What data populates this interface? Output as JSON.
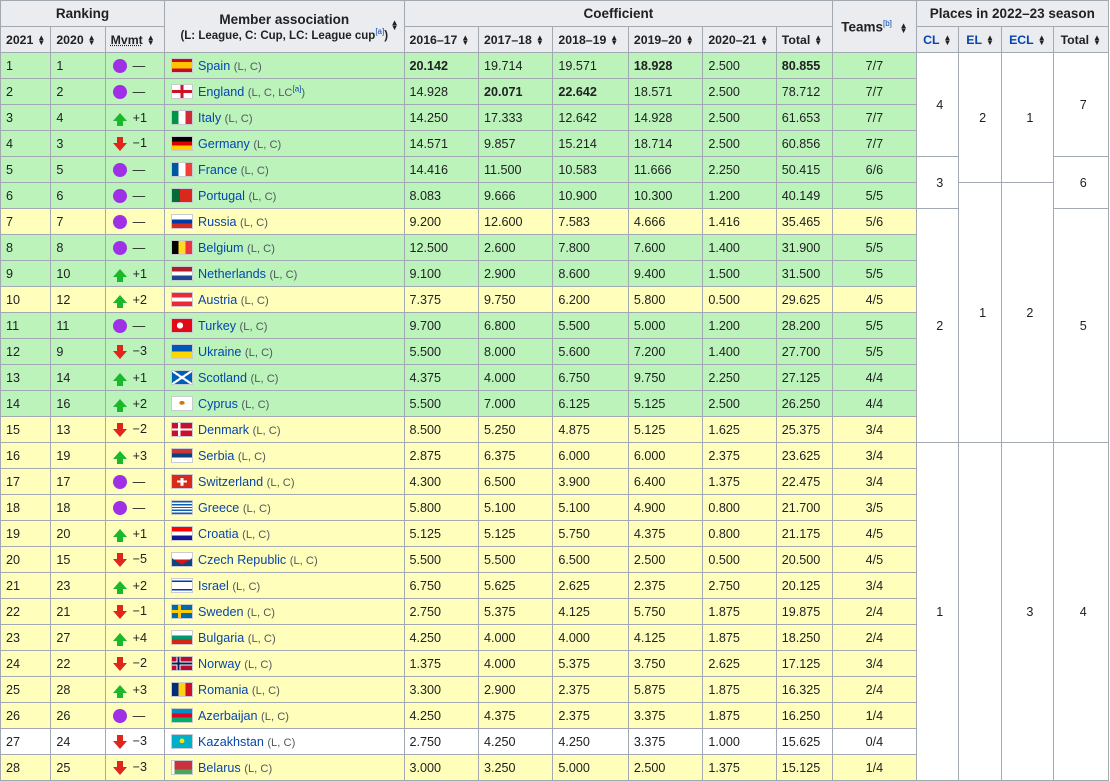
{
  "headers": {
    "ranking": "Ranking",
    "member_association": "Member association",
    "member_note": "(L: League, C: Cup, LC: League cup",
    "member_note_ref": "[a]",
    "member_note_close": ")",
    "coefficient": "Coefficient",
    "teams": "Teams",
    "teams_ref": "[b]",
    "places": "Places in 2022–23 season",
    "col_2021": "2021",
    "col_2020": "2020",
    "col_mvmt": "Mvmt",
    "seasons": [
      "2016–17",
      "2017–18",
      "2018–19",
      "2019–20",
      "2020–21",
      "Total"
    ],
    "places_cols": [
      "CL",
      "EL",
      "ECL",
      "Total"
    ]
  },
  "rows": [
    {
      "r2021": "1",
      "r2020": "1",
      "mv": "same",
      "mvt": "—",
      "name": "Spain",
      "comp": "(L, C)",
      "c": [
        "20.142",
        "19.714",
        "19.571",
        "18.928",
        "2.500",
        "80.855"
      ],
      "bold": [
        true,
        false,
        false,
        true,
        false,
        true
      ],
      "teams": "7/7",
      "bg": "g",
      "flag": "es"
    },
    {
      "r2021": "2",
      "r2020": "2",
      "mv": "same",
      "mvt": "—",
      "name": "England",
      "comp": "(L, C, LC",
      "compref": "[a]",
      "compclose": ")",
      "c": [
        "14.928",
        "20.071",
        "22.642",
        "18.571",
        "2.500",
        "78.712"
      ],
      "bold": [
        false,
        true,
        true,
        false,
        false,
        false
      ],
      "teams": "7/7",
      "bg": "g",
      "flag": "en"
    },
    {
      "r2021": "3",
      "r2020": "4",
      "mv": "up",
      "mvt": "+1",
      "name": "Italy",
      "comp": "(L, C)",
      "c": [
        "14.250",
        "17.333",
        "12.642",
        "14.928",
        "2.500",
        "61.653"
      ],
      "teams": "7/7",
      "bg": "g",
      "flag": "it"
    },
    {
      "r2021": "4",
      "r2020": "3",
      "mv": "down",
      "mvt": "−1",
      "name": "Germany",
      "comp": "(L, C)",
      "c": [
        "14.571",
        "9.857",
        "15.214",
        "18.714",
        "2.500",
        "60.856"
      ],
      "teams": "7/7",
      "bg": "g",
      "flag": "de"
    },
    {
      "r2021": "5",
      "r2020": "5",
      "mv": "same",
      "mvt": "—",
      "name": "France",
      "comp": "(L, C)",
      "c": [
        "14.416",
        "11.500",
        "10.583",
        "11.666",
        "2.250",
        "50.415"
      ],
      "teams": "6/6",
      "bg": "g",
      "flag": "fr"
    },
    {
      "r2021": "6",
      "r2020": "6",
      "mv": "same",
      "mvt": "—",
      "name": "Portugal",
      "comp": "(L, C)",
      "c": [
        "8.083",
        "9.666",
        "10.900",
        "10.300",
        "1.200",
        "40.149"
      ],
      "teams": "5/5",
      "bg": "g",
      "flag": "pt"
    },
    {
      "r2021": "7",
      "r2020": "7",
      "mv": "same",
      "mvt": "—",
      "name": "Russia",
      "comp": "(L, C)",
      "c": [
        "9.200",
        "12.600",
        "7.583",
        "4.666",
        "1.416",
        "35.465"
      ],
      "teams": "5/6",
      "bg": "y",
      "flag": "ru"
    },
    {
      "r2021": "8",
      "r2020": "8",
      "mv": "same",
      "mvt": "—",
      "name": "Belgium",
      "comp": "(L, C)",
      "c": [
        "12.500",
        "2.600",
        "7.800",
        "7.600",
        "1.400",
        "31.900"
      ],
      "teams": "5/5",
      "bg": "g",
      "flag": "be"
    },
    {
      "r2021": "9",
      "r2020": "10",
      "mv": "up",
      "mvt": "+1",
      "name": "Netherlands",
      "comp": "(L, C)",
      "c": [
        "9.100",
        "2.900",
        "8.600",
        "9.400",
        "1.500",
        "31.500"
      ],
      "teams": "5/5",
      "bg": "g",
      "flag": "nl"
    },
    {
      "r2021": "10",
      "r2020": "12",
      "mv": "up",
      "mvt": "+2",
      "name": "Austria",
      "comp": "(L, C)",
      "c": [
        "7.375",
        "9.750",
        "6.200",
        "5.800",
        "0.500",
        "29.625"
      ],
      "teams": "4/5",
      "bg": "y",
      "flag": "at"
    },
    {
      "r2021": "11",
      "r2020": "11",
      "mv": "same",
      "mvt": "—",
      "name": "Turkey",
      "comp": "(L, C)",
      "c": [
        "9.700",
        "6.800",
        "5.500",
        "5.000",
        "1.200",
        "28.200"
      ],
      "teams": "5/5",
      "bg": "g",
      "flag": "tr"
    },
    {
      "r2021": "12",
      "r2020": "9",
      "mv": "down",
      "mvt": "−3",
      "name": "Ukraine",
      "comp": "(L, C)",
      "c": [
        "5.500",
        "8.000",
        "5.600",
        "7.200",
        "1.400",
        "27.700"
      ],
      "teams": "5/5",
      "bg": "g",
      "flag": "ua"
    },
    {
      "r2021": "13",
      "r2020": "14",
      "mv": "up",
      "mvt": "+1",
      "name": "Scotland",
      "comp": "(L, C)",
      "c": [
        "4.375",
        "4.000",
        "6.750",
        "9.750",
        "2.250",
        "27.125"
      ],
      "teams": "4/4",
      "bg": "g",
      "flag": "sc"
    },
    {
      "r2021": "14",
      "r2020": "16",
      "mv": "up",
      "mvt": "+2",
      "name": "Cyprus",
      "comp": "(L, C)",
      "c": [
        "5.500",
        "7.000",
        "6.125",
        "5.125",
        "2.500",
        "26.250"
      ],
      "teams": "4/4",
      "bg": "g",
      "flag": "cy"
    },
    {
      "r2021": "15",
      "r2020": "13",
      "mv": "down",
      "mvt": "−2",
      "name": "Denmark",
      "comp": "(L, C)",
      "c": [
        "8.500",
        "5.250",
        "4.875",
        "5.125",
        "1.625",
        "25.375"
      ],
      "teams": "3/4",
      "bg": "y",
      "flag": "dk"
    },
    {
      "r2021": "16",
      "r2020": "19",
      "mv": "up",
      "mvt": "+3",
      "name": "Serbia",
      "comp": "(L, C)",
      "c": [
        "2.875",
        "6.375",
        "6.000",
        "6.000",
        "2.375",
        "23.625"
      ],
      "teams": "3/4",
      "bg": "y",
      "flag": "rs"
    },
    {
      "r2021": "17",
      "r2020": "17",
      "mv": "same",
      "mvt": "—",
      "name": "Switzerland",
      "comp": "(L, C)",
      "c": [
        "4.300",
        "6.500",
        "3.900",
        "6.400",
        "1.375",
        "22.475"
      ],
      "teams": "3/4",
      "bg": "y",
      "flag": "ch"
    },
    {
      "r2021": "18",
      "r2020": "18",
      "mv": "same",
      "mvt": "—",
      "name": "Greece",
      "comp": "(L, C)",
      "c": [
        "5.800",
        "5.100",
        "5.100",
        "4.900",
        "0.800",
        "21.700"
      ],
      "teams": "3/5",
      "bg": "y",
      "flag": "gr"
    },
    {
      "r2021": "19",
      "r2020": "20",
      "mv": "up",
      "mvt": "+1",
      "name": "Croatia",
      "comp": "(L, C)",
      "c": [
        "5.125",
        "5.125",
        "5.750",
        "4.375",
        "0.800",
        "21.175"
      ],
      "teams": "4/5",
      "bg": "y",
      "flag": "hr"
    },
    {
      "r2021": "20",
      "r2020": "15",
      "mv": "down",
      "mvt": "−5",
      "name": "Czech Republic",
      "comp": "(L, C)",
      "c": [
        "5.500",
        "5.500",
        "6.500",
        "2.500",
        "0.500",
        "20.500"
      ],
      "teams": "4/5",
      "bg": "y",
      "flag": "cz"
    },
    {
      "r2021": "21",
      "r2020": "23",
      "mv": "up",
      "mvt": "+2",
      "name": "Israel",
      "comp": "(L, C)",
      "c": [
        "6.750",
        "5.625",
        "2.625",
        "2.375",
        "2.750",
        "20.125"
      ],
      "teams": "3/4",
      "bg": "y",
      "flag": "il"
    },
    {
      "r2021": "22",
      "r2020": "21",
      "mv": "down",
      "mvt": "−1",
      "name": "Sweden",
      "comp": "(L, C)",
      "c": [
        "2.750",
        "5.375",
        "4.125",
        "5.750",
        "1.875",
        "19.875"
      ],
      "teams": "2/4",
      "bg": "y",
      "flag": "se"
    },
    {
      "r2021": "23",
      "r2020": "27",
      "mv": "up",
      "mvt": "+4",
      "name": "Bulgaria",
      "comp": "(L, C)",
      "c": [
        "4.250",
        "4.000",
        "4.000",
        "4.125",
        "1.875",
        "18.250"
      ],
      "teams": "2/4",
      "bg": "y",
      "flag": "bg"
    },
    {
      "r2021": "24",
      "r2020": "22",
      "mv": "down",
      "mvt": "−2",
      "name": "Norway",
      "comp": "(L, C)",
      "c": [
        "1.375",
        "4.000",
        "5.375",
        "3.750",
        "2.625",
        "17.125"
      ],
      "teams": "3/4",
      "bg": "y",
      "flag": "no"
    },
    {
      "r2021": "25",
      "r2020": "28",
      "mv": "up",
      "mvt": "+3",
      "name": "Romania",
      "comp": "(L, C)",
      "c": [
        "3.300",
        "2.900",
        "2.375",
        "5.875",
        "1.875",
        "16.325"
      ],
      "teams": "2/4",
      "bg": "y",
      "flag": "ro"
    },
    {
      "r2021": "26",
      "r2020": "26",
      "mv": "same",
      "mvt": "—",
      "name": "Azerbaijan",
      "comp": "(L, C)",
      "c": [
        "4.250",
        "4.375",
        "2.375",
        "3.375",
        "1.875",
        "16.250"
      ],
      "teams": "1/4",
      "bg": "y",
      "flag": "az"
    },
    {
      "r2021": "27",
      "r2020": "24",
      "mv": "down",
      "mvt": "−3",
      "name": "Kazakhstan",
      "comp": "(L, C)",
      "c": [
        "2.750",
        "4.250",
        "4.250",
        "3.375",
        "1.000",
        "15.625"
      ],
      "teams": "0/4",
      "bg": "w",
      "flag": "kz"
    },
    {
      "r2021": "28",
      "r2020": "25",
      "mv": "down",
      "mvt": "−3",
      "name": "Belarus",
      "comp": "(L, C)",
      "c": [
        "3.000",
        "3.250",
        "5.000",
        "2.500",
        "1.375",
        "15.125"
      ],
      "teams": "1/4",
      "bg": "y",
      "flag": "by"
    }
  ],
  "places": {
    "cl": [
      {
        "value": "4",
        "rowspan": 4
      },
      {
        "value": "3",
        "rowspan": 2
      },
      {
        "value": "2",
        "rowspan": 9
      },
      {
        "value": "1",
        "rowspan": 13
      }
    ],
    "el": [
      {
        "value": "2",
        "rowspan": 5
      },
      {
        "value": "1",
        "rowspan": 10
      },
      {
        "value": "",
        "rowspan": 13
      }
    ],
    "ecl": [
      {
        "value": "1",
        "rowspan": 5
      },
      {
        "value": "2",
        "rowspan": 10
      },
      {
        "value": "3",
        "rowspan": 13
      }
    ],
    "total": [
      {
        "value": "7",
        "rowspan": 4
      },
      {
        "value": "6",
        "rowspan": 2
      },
      {
        "value": "5",
        "rowspan": 9
      },
      {
        "value": "4",
        "rowspan": 13
      }
    ]
  },
  "colors": {
    "green": "#bbf3bb",
    "yellow": "#ffffbb",
    "header": "#eaecf0",
    "border": "#a2a9b1",
    "link": "#0645ad",
    "same": "#9f30e6",
    "up": "#1bb82b",
    "down": "#e0251b"
  }
}
